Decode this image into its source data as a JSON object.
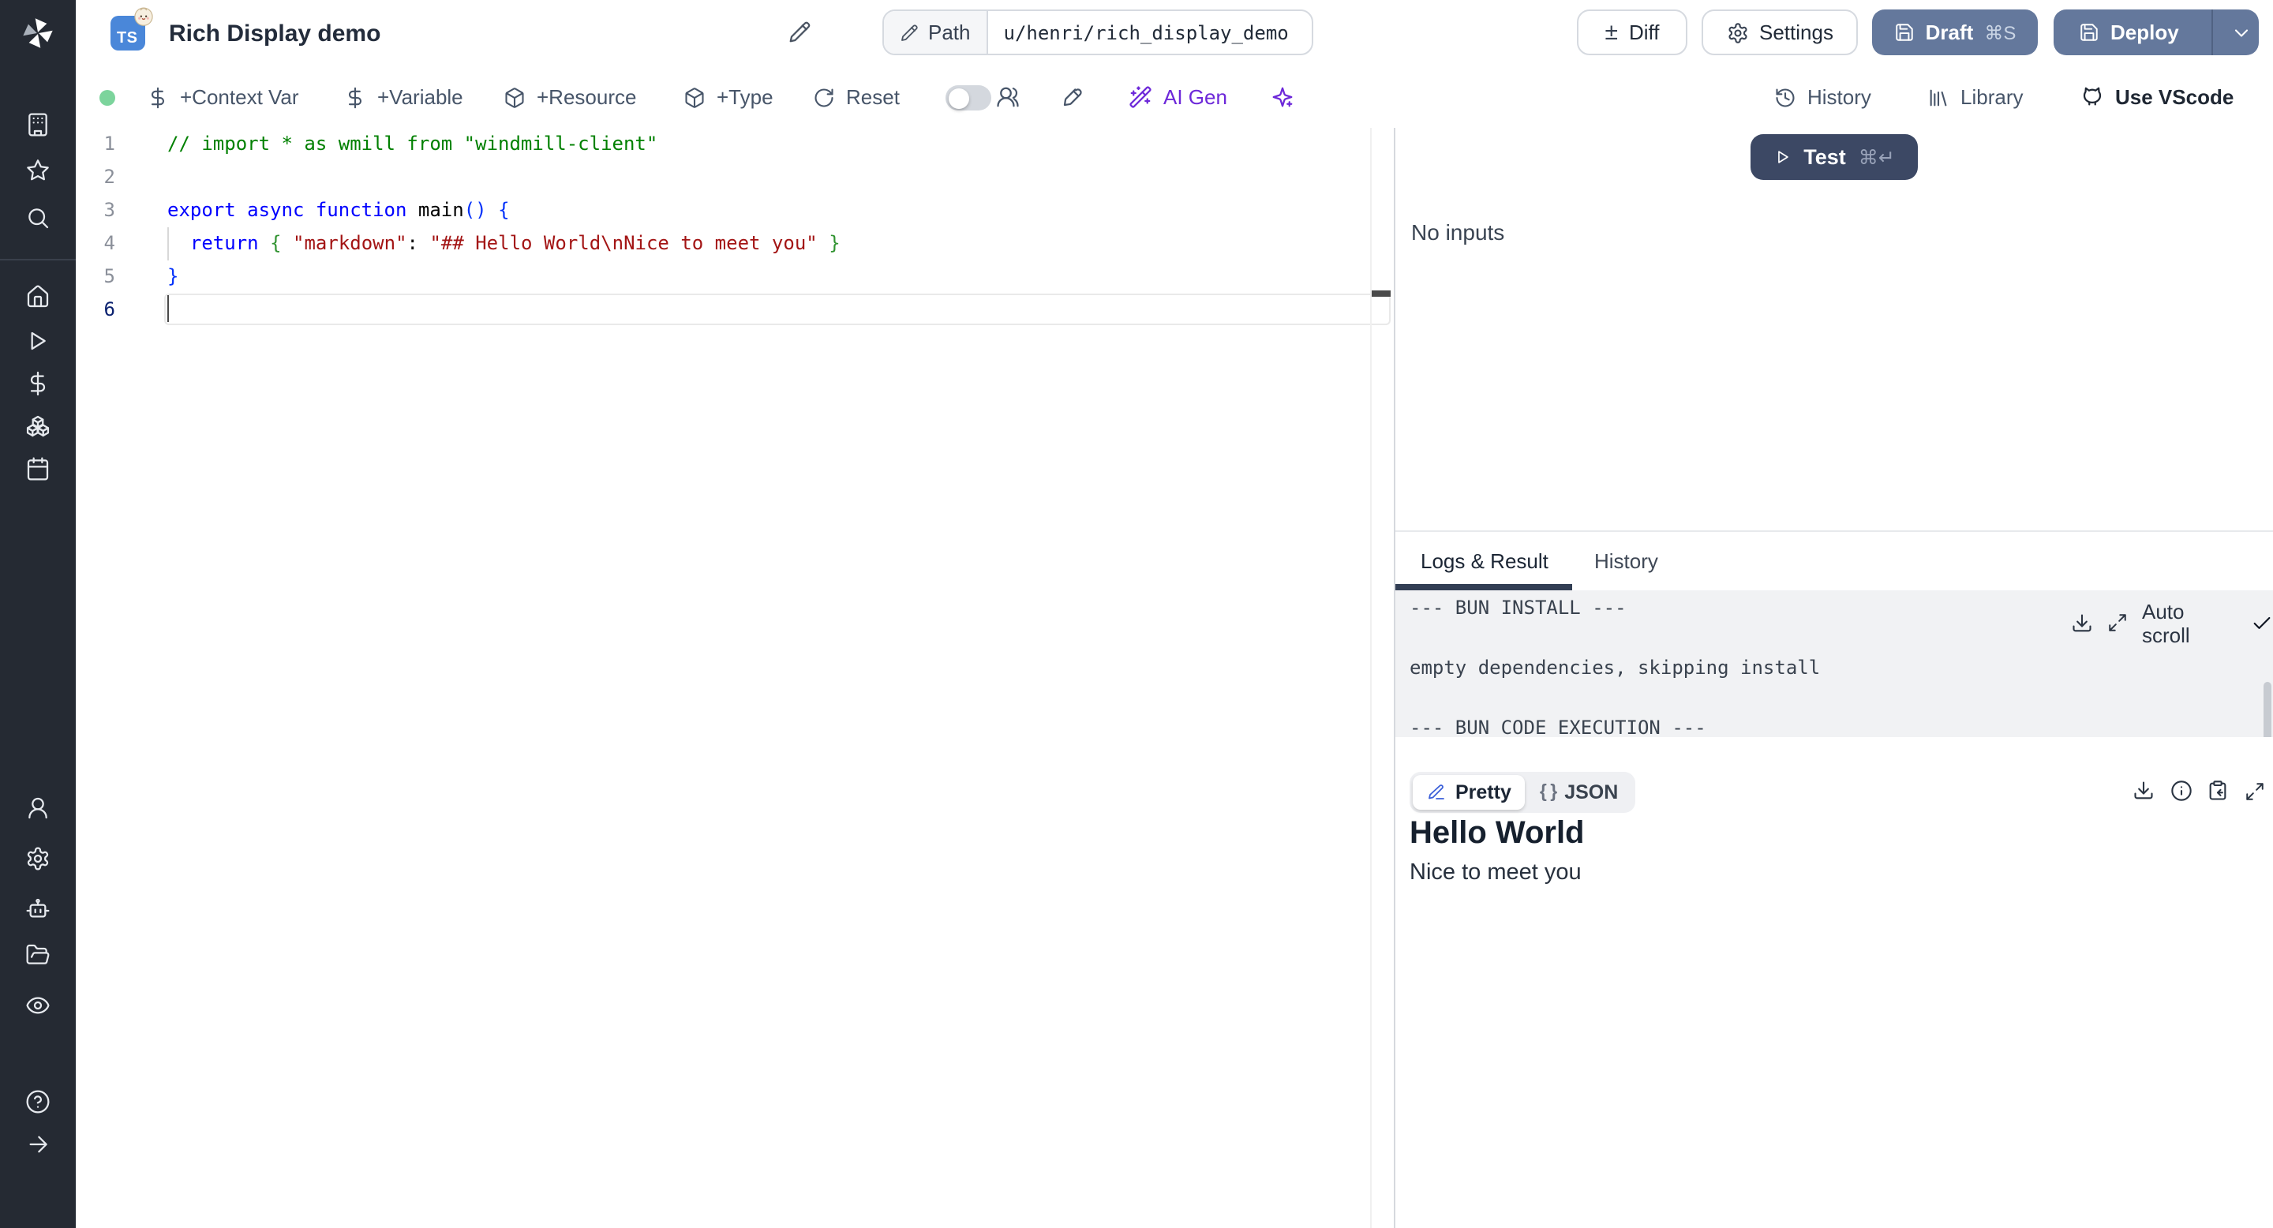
{
  "window": {
    "title": "Rich Display demo",
    "language_badge": "TS",
    "path_label": "Path",
    "path_value": "u/henri/rich_display_demo"
  },
  "header": {
    "diff": "Diff",
    "settings": "Settings",
    "draft": "Draft",
    "draft_shortcut": "⌘S",
    "deploy": "Deploy"
  },
  "toolbar": {
    "buttons": [
      {
        "icon": "dollar",
        "label": "+Context Var"
      },
      {
        "icon": "dollar",
        "label": "+Variable"
      },
      {
        "icon": "package",
        "label": "+Resource"
      },
      {
        "icon": "package",
        "label": "+Type"
      },
      {
        "icon": "rotate",
        "label": "Reset"
      }
    ],
    "ai_gen_label": "AI Gen",
    "right": [
      {
        "icon": "history",
        "label": "History"
      },
      {
        "icon": "library",
        "label": "Library"
      },
      {
        "icon": "cat",
        "label": "Use VScode"
      }
    ]
  },
  "sidebar": {
    "groups": [
      [
        "building",
        "star",
        "search"
      ],
      [
        "home",
        "play",
        "dollar",
        "boxes",
        "calendar"
      ],
      [
        "user",
        "settings",
        "bot",
        "folder",
        "eye"
      ],
      [
        "help",
        "arrow-right"
      ]
    ]
  },
  "editor": {
    "lines": [
      {
        "n": "1",
        "tokens": [
          {
            "t": "// import * as wmill from \"windmill-client\"",
            "c": "com"
          }
        ]
      },
      {
        "n": "2",
        "tokens": []
      },
      {
        "n": "3",
        "tokens": [
          {
            "t": "export async function ",
            "c": "kw"
          },
          {
            "t": "main",
            "c": "fn"
          },
          {
            "t": "() {",
            "c": "b1"
          }
        ]
      },
      {
        "n": "4",
        "tokens": [
          {
            "t": "  ",
            "c": "pl"
          },
          {
            "t": "return",
            "c": "kw"
          },
          {
            "t": " ",
            "c": "pl"
          },
          {
            "t": "{",
            "c": "b2"
          },
          {
            "t": " ",
            "c": "pl"
          },
          {
            "t": "\"markdown\"",
            "c": "str"
          },
          {
            "t": ": ",
            "c": "pl"
          },
          {
            "t": "\"## Hello World\\nNice to meet you\"",
            "c": "str"
          },
          {
            "t": " ",
            "c": "pl"
          },
          {
            "t": "}",
            "c": "b2"
          }
        ]
      },
      {
        "n": "5",
        "tokens": [
          {
            "t": "}",
            "c": "b1"
          }
        ]
      },
      {
        "n": "6",
        "tokens": []
      }
    ]
  },
  "run": {
    "test_label": "Test",
    "test_shortcut": "⌘↵",
    "no_inputs": "No inputs"
  },
  "tabs": [
    {
      "label": "Logs & Result",
      "active": true
    },
    {
      "label": "History",
      "active": false
    }
  ],
  "log": {
    "lines": [
      "--- BUN INSTALL ---",
      "",
      "empty dependencies, skipping install",
      "",
      "--- BUN CODE EXECUTION ---"
    ],
    "auto_scroll_label": "Auto scroll"
  },
  "result": {
    "pretty_label": "Pretty",
    "json_label": "JSON",
    "json_glyph": "{ }",
    "heading": "Hello World",
    "body": "Nice to meet you"
  },
  "colors": {
    "accent_slate": "#64789c",
    "test_button": "#3c4864",
    "ts_badge": "#4a87d9",
    "ai_purple": "#6d28d9",
    "status_green": "#7cd49c",
    "log_bg": "#f1f2f4",
    "code": {
      "comment": "#008000",
      "keyword": "#0000ff",
      "function": "#000000",
      "bracket1": "#0431fa",
      "bracket2": "#319331",
      "string": "#a31515"
    }
  }
}
